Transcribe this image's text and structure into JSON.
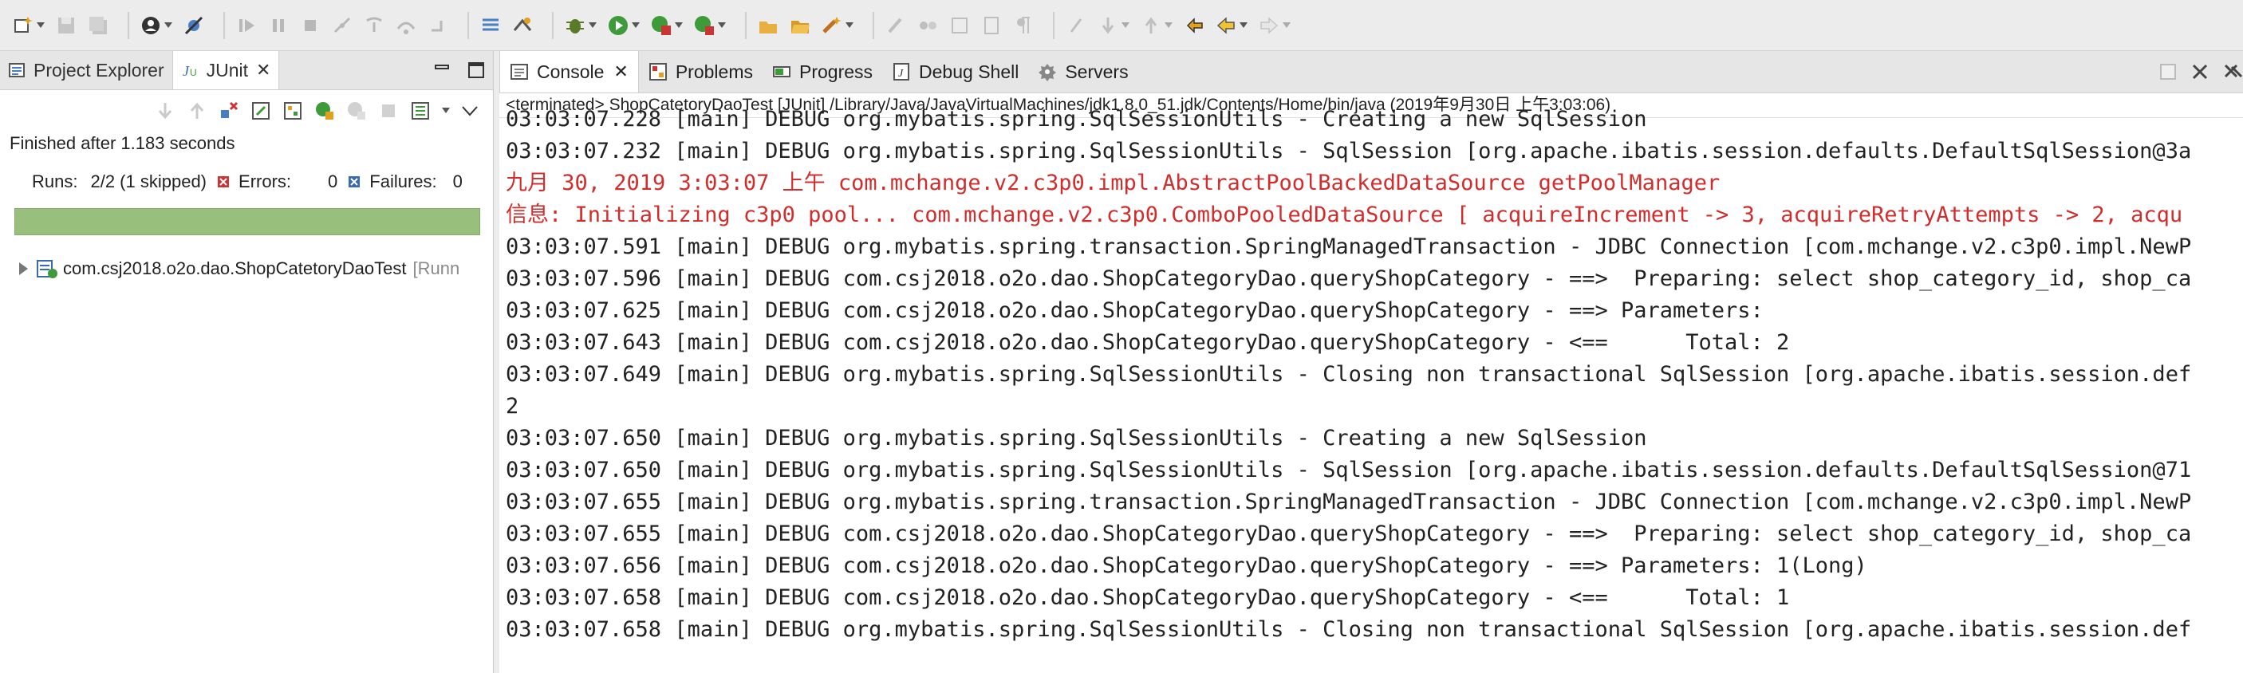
{
  "left_panel": {
    "tabs": [
      {
        "label": "Project Explorer",
        "icon": "project-explorer-icon"
      },
      {
        "label": "JUnit",
        "icon": "junit-icon",
        "active": true
      }
    ],
    "finished": "Finished after 1.183 seconds",
    "runs_label": "Runs:",
    "runs_value": "2/2 (1 skipped)",
    "errors_label": "Errors:",
    "errors_value": "0",
    "failures_label": "Failures:",
    "failures_value": "0",
    "progress": 1.0,
    "tree": [
      {
        "label": "com.csj2018.o2o.dao.ShopCatetoryDaoTest",
        "time": "[Runn"
      }
    ]
  },
  "console_panel": {
    "tabs": [
      {
        "label": "Console",
        "icon": "console-icon",
        "active": true
      },
      {
        "label": "Problems",
        "icon": "problems-icon"
      },
      {
        "label": "Progress",
        "icon": "progress-icon"
      },
      {
        "label": "Debug Shell",
        "icon": "debug-shell-icon"
      },
      {
        "label": "Servers",
        "icon": "servers-icon"
      }
    ],
    "terminated": "<terminated> ShopCatetoryDaoTest [JUnit] /Library/Java/JavaVirtualMachines/jdk1.8.0_51.jdk/Contents/Home/bin/java  (2019年9月30日 上午3:03:06)",
    "lines": [
      {
        "text": "03:03:07.228 [main] DEBUG org.mybatis.spring.SqlSessionUtils - Creating a new SqlSession",
        "red": false
      },
      {
        "text": "03:03:07.232 [main] DEBUG org.mybatis.spring.SqlSessionUtils - SqlSession [org.apache.ibatis.session.defaults.DefaultSqlSession@3a",
        "red": false
      },
      {
        "text": "九月 30, 2019 3:03:07 上午 com.mchange.v2.c3p0.impl.AbstractPoolBackedDataSource getPoolManager",
        "red": true
      },
      {
        "text": "信息: Initializing c3p0 pool... com.mchange.v2.c3p0.ComboPooledDataSource [ acquireIncrement -> 3, acquireRetryAttempts -> 2, acqu",
        "red": true
      },
      {
        "text": "03:03:07.591 [main] DEBUG org.mybatis.spring.transaction.SpringManagedTransaction - JDBC Connection [com.mchange.v2.c3p0.impl.NewP",
        "red": false
      },
      {
        "text": "03:03:07.596 [main] DEBUG com.csj2018.o2o.dao.ShopCategoryDao.queryShopCategory - ==>  Preparing: select shop_category_id, shop_ca",
        "red": false
      },
      {
        "text": "03:03:07.625 [main] DEBUG com.csj2018.o2o.dao.ShopCategoryDao.queryShopCategory - ==> Parameters: ",
        "red": false
      },
      {
        "text": "03:03:07.643 [main] DEBUG com.csj2018.o2o.dao.ShopCategoryDao.queryShopCategory - <==      Total: 2",
        "red": false
      },
      {
        "text": "03:03:07.649 [main] DEBUG org.mybatis.spring.SqlSessionUtils - Closing non transactional SqlSession [org.apache.ibatis.session.def",
        "red": false
      },
      {
        "text": "2",
        "red": false
      },
      {
        "text": "03:03:07.650 [main] DEBUG org.mybatis.spring.SqlSessionUtils - Creating a new SqlSession",
        "red": false
      },
      {
        "text": "03:03:07.650 [main] DEBUG org.mybatis.spring.SqlSessionUtils - SqlSession [org.apache.ibatis.session.defaults.DefaultSqlSession@71",
        "red": false
      },
      {
        "text": "03:03:07.655 [main] DEBUG org.mybatis.spring.transaction.SpringManagedTransaction - JDBC Connection [com.mchange.v2.c3p0.impl.NewP",
        "red": false
      },
      {
        "text": "03:03:07.655 [main] DEBUG com.csj2018.o2o.dao.ShopCategoryDao.queryShopCategory - ==>  Preparing: select shop_category_id, shop_ca",
        "red": false
      },
      {
        "text": "03:03:07.656 [main] DEBUG com.csj2018.o2o.dao.ShopCategoryDao.queryShopCategory - ==> Parameters: 1(Long)",
        "red": false
      },
      {
        "text": "03:03:07.658 [main] DEBUG com.csj2018.o2o.dao.ShopCategoryDao.queryShopCategory - <==      Total: 1",
        "red": false
      },
      {
        "text": "03:03:07.658 [main] DEBUG org.mybatis.spring.SqlSessionUtils - Closing non transactional SqlSession [org.apache.ibatis.session.def",
        "red": false
      }
    ]
  },
  "colors": {
    "progress_green": "#98bf7c",
    "stderr_red": "#d12d2d"
  }
}
